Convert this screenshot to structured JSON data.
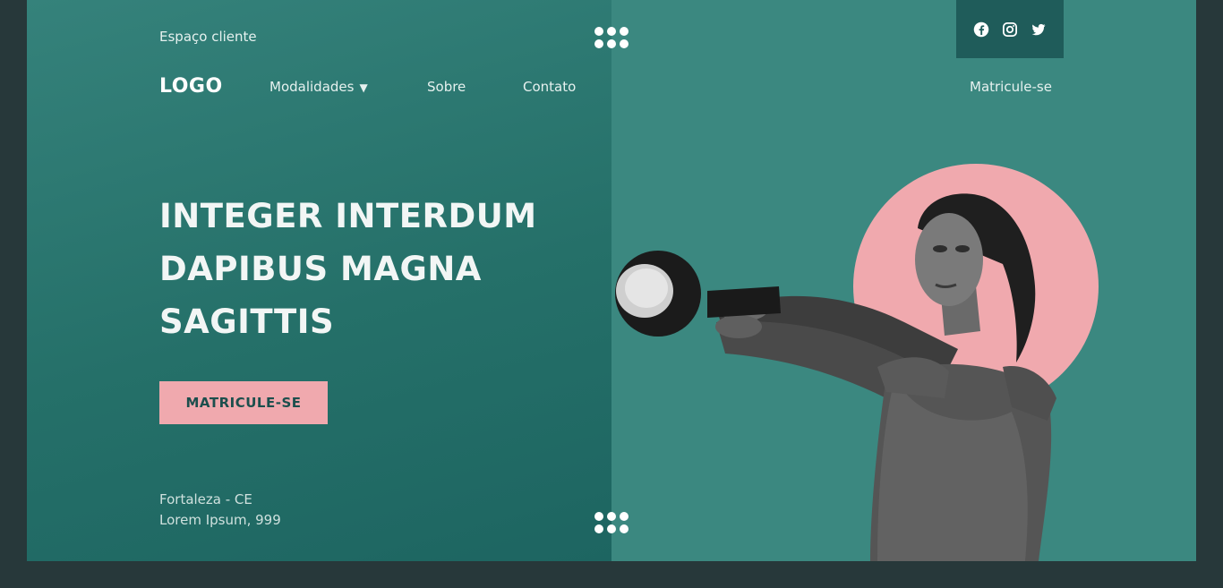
{
  "topbar": {
    "client_area": "Espaço cliente"
  },
  "social": {
    "facebook": "facebook-icon",
    "instagram": "instagram-icon",
    "twitter": "twitter-icon"
  },
  "nav": {
    "logo": "LOGO",
    "items": [
      {
        "label": "Modalidades",
        "caret": "▼"
      },
      {
        "label": "Sobre"
      },
      {
        "label": "Contato"
      }
    ],
    "enroll": "Matricule-se"
  },
  "hero": {
    "lines": [
      "INTEGER INTERDUM",
      "DAPIBUS MAGNA",
      "SAGITTIS"
    ],
    "cta": "MATRICULE-SE"
  },
  "footer": {
    "city": "Fortaleza - CE",
    "street": "Lorem Ipsum, 999"
  },
  "colors": {
    "page_bg": "#27383a",
    "hero_bg": "#3b8880",
    "panel_dark": "#1f5c5a",
    "accent_pink": "#f0a9ae"
  }
}
